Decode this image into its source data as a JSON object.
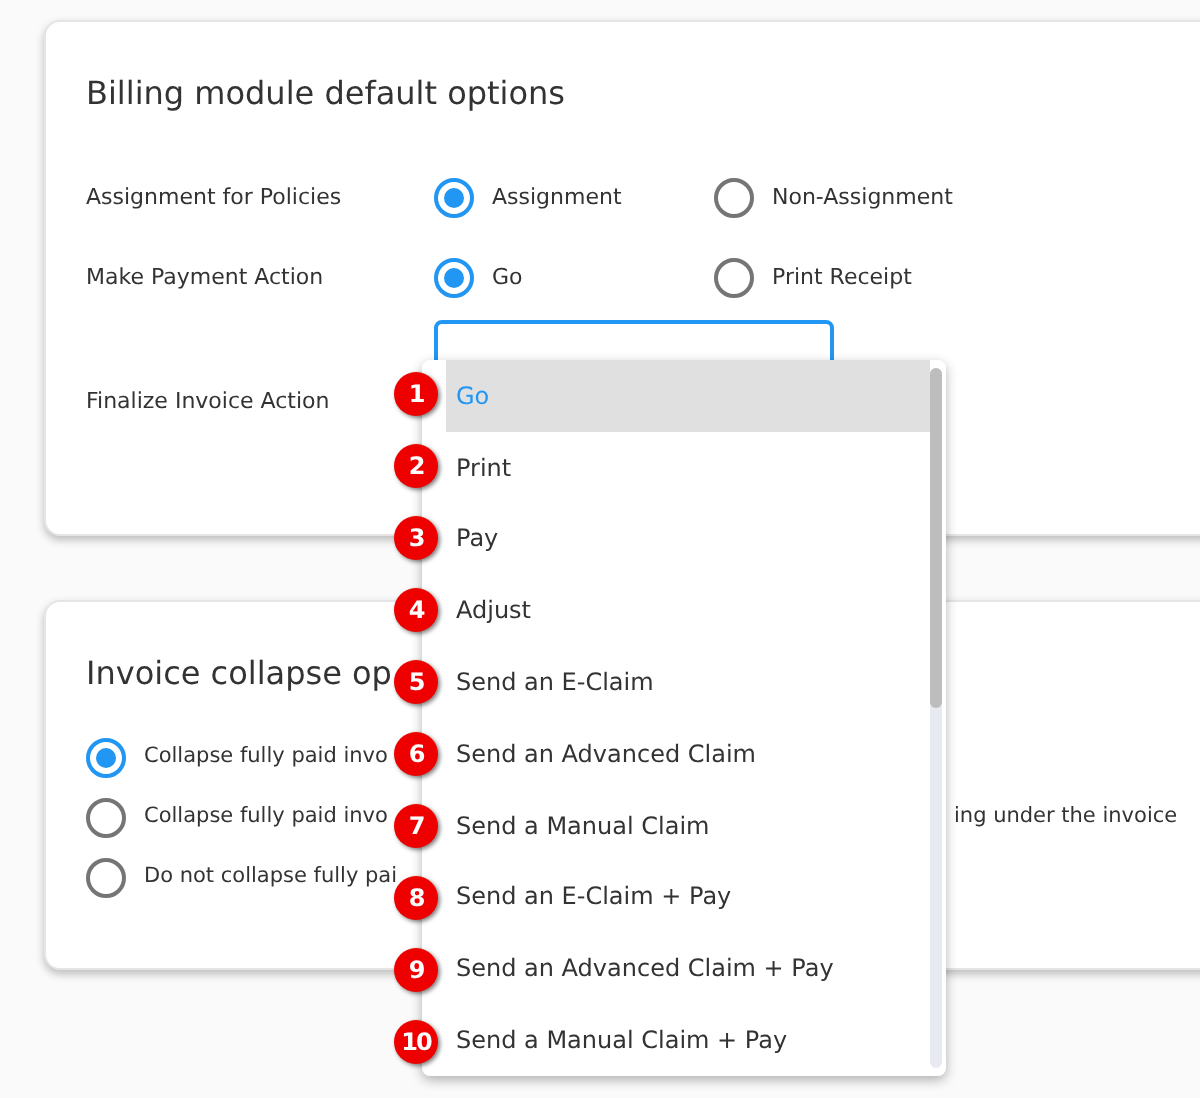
{
  "billing": {
    "title": "Billing module default options",
    "settings": [
      {
        "label": "Assignment for Policies",
        "options": [
          {
            "label": "Assignment",
            "selected": true
          },
          {
            "label": "Non-Assignment",
            "selected": false
          }
        ]
      },
      {
        "label": "Make Payment Action",
        "options": [
          {
            "label": "Go",
            "selected": true
          },
          {
            "label": "Print Receipt",
            "selected": false
          }
        ]
      }
    ],
    "finalize": {
      "label": "Finalize Invoice Action",
      "menu": [
        {
          "badge": "1",
          "label": "Go",
          "selected": true
        },
        {
          "badge": "2",
          "label": "Print",
          "selected": false
        },
        {
          "badge": "3",
          "label": "Pay",
          "selected": false
        },
        {
          "badge": "4",
          "label": "Adjust",
          "selected": false
        },
        {
          "badge": "5",
          "label": "Send an E-Claim",
          "selected": false
        },
        {
          "badge": "6",
          "label": "Send an Advanced Claim",
          "selected": false
        },
        {
          "badge": "7",
          "label": "Send a Manual Claim",
          "selected": false
        },
        {
          "badge": "8",
          "label": "Send an E-Claim + Pay",
          "selected": false
        },
        {
          "badge": "9",
          "label": "Send an Advanced Claim + Pay",
          "selected": false
        },
        {
          "badge": "10",
          "label": "Send a Manual Claim + Pay",
          "selected": false
        }
      ]
    }
  },
  "collapse": {
    "title": "Invoice collapse op",
    "options": [
      {
        "label": "Collapse fully paid invo",
        "selected": true
      },
      {
        "label": "Collapse fully paid invo",
        "continued": "ing under the invoice",
        "selected": false
      },
      {
        "label": "Do not collapse fully pai",
        "selected": false
      }
    ]
  }
}
